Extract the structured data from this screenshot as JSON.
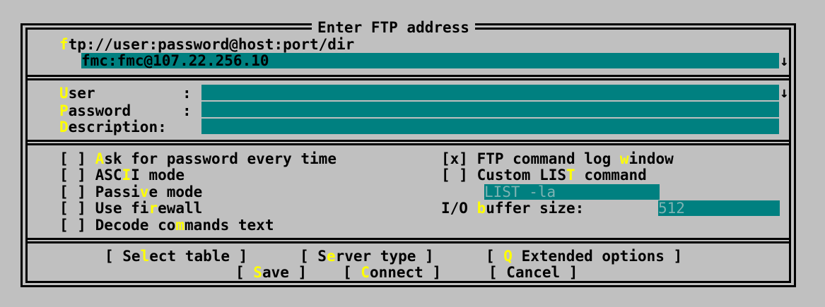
{
  "dialog": {
    "title": "Enter FTP address",
    "url_hint_hot": "f",
    "url_hint_rest": "tp://user:password@host:port/dir",
    "address_value": "fmc:fmc@107.22.256.10",
    "dropdown_arrow": "↓"
  },
  "credentials": {
    "user_hot": "U",
    "user_rest": "ser",
    "user_sep": "   :",
    "password_hot": "P",
    "password_rest": "assword",
    "password_sep": "   :",
    "description_hot": "D",
    "description_rest": "escription:",
    "user_value": "",
    "password_value": "",
    "description_value": ""
  },
  "options": {
    "ask_password": {
      "box": "[ ]",
      "pre": " ",
      "hot": "A",
      "post": "sk for password every time",
      "checked": false
    },
    "ascii_mode": {
      "box": "[ ]",
      "pre": " ASC",
      "hot": "I",
      "post": "I mode",
      "checked": false
    },
    "passive_mode": {
      "box": "[ ]",
      "pre": " Passi",
      "hot": "v",
      "post": "e mode",
      "checked": false
    },
    "use_firewall": {
      "box": "[ ]",
      "pre": " Use fi",
      "hot": "r",
      "post": "ewall",
      "checked": false
    },
    "decode_commands": {
      "box": "[ ]",
      "pre": " Decode co",
      "hot": "m",
      "post": "mands text",
      "checked": false
    },
    "ftp_log_window": {
      "box": "[x]",
      "pre": " FTP command log ",
      "hot": "w",
      "post": "indow",
      "checked": true
    },
    "custom_list": {
      "box": "[ ]",
      "pre": " Custom LIS",
      "hot": "T",
      "post": " command",
      "checked": false
    },
    "list_command_value": "LIST -la",
    "io_buffer_pre": "I/O ",
    "io_buffer_hot": "b",
    "io_buffer_post": "uffer size:",
    "io_buffer_value": "512"
  },
  "buttons": {
    "select_table": {
      "open": "[ Se",
      "hot": "l",
      "close": "ect table ]"
    },
    "server_type": {
      "open": "[ S",
      "hot": "e",
      "close": "rver type ]"
    },
    "extended_options": {
      "open": "[ ",
      "hot": "Q",
      "close": " Extended options ]"
    },
    "save": {
      "open": "[ ",
      "hot": "S",
      "close": "ave ]"
    },
    "connect": {
      "open": "[ ",
      "hot": "C",
      "close": "onnect ]"
    },
    "cancel": {
      "open": "[ ",
      "hot": "",
      "close": "Cancel ]"
    }
  },
  "colors": {
    "background": "#c0c0c0",
    "field": "#008080",
    "hotkey": "#ffff00"
  }
}
